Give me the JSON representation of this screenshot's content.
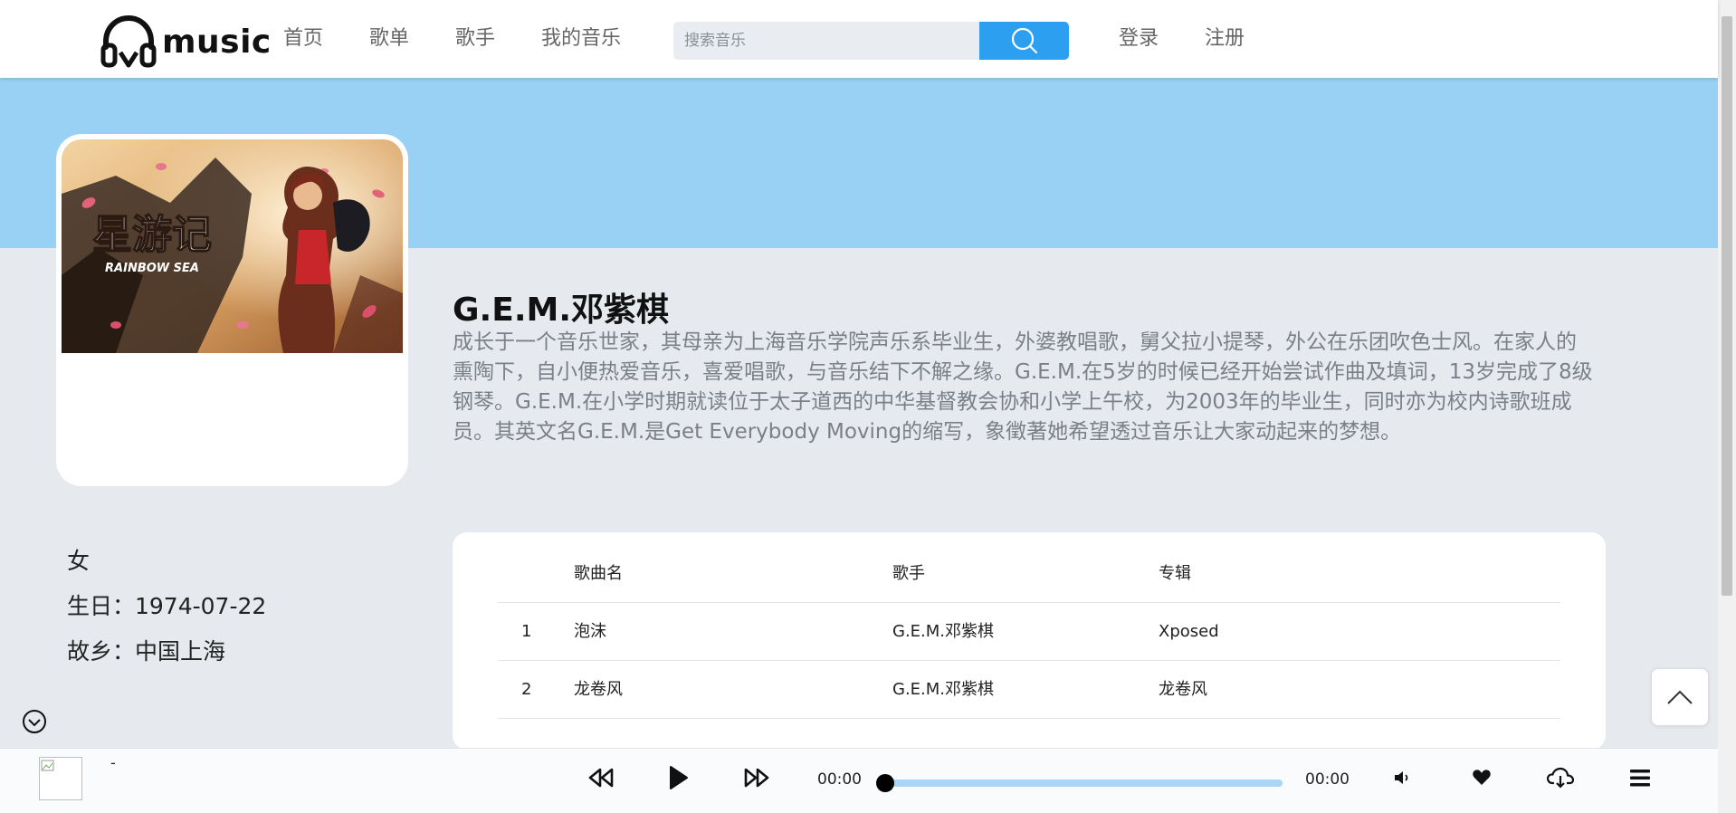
{
  "header": {
    "logo_text": "music",
    "nav": [
      "首页",
      "歌单",
      "歌手",
      "我的音乐"
    ],
    "search_placeholder": "搜索音乐",
    "login": "登录",
    "register": "注册"
  },
  "artist": {
    "name": "G.E.M.邓紫棋",
    "intro": "成长于一个音乐世家，其母亲为上海音乐学院声乐系毕业生，外婆教唱歌，舅父拉小提琴，外公在乐团吹色士风。在家人的熏陶下，自小便热爱音乐，喜爱唱歌，与音乐结下不解之缘。G.E.M.在5岁的时候已经开始尝试作曲及填词，13岁完成了8级钢琴。G.E.M.在小学时期就读位于太子道西的中华基督教会协和小学上午校，为2003年的毕业生，同时亦为校内诗歌班成员。其英文名G.E.M.是Get Everybody Moving的缩写，象徵著她希望透过音乐让大家动起来的梦想。",
    "cover_text": "星游记",
    "cover_subtext": "RAINBOW SEA",
    "gender": "女",
    "birthday": "生日：1974-07-22",
    "hometown": "故乡：中国上海"
  },
  "songs": {
    "columns": [
      "",
      "歌曲名",
      "歌手",
      "专辑"
    ],
    "rows": [
      {
        "index": "1",
        "name": "泡沫",
        "singer": "G.E.M.邓紫棋",
        "album": "Xposed"
      },
      {
        "index": "2",
        "name": "龙卷风",
        "singer": "G.E.M.邓紫棋",
        "album": "龙卷风"
      }
    ]
  },
  "player": {
    "title": "-",
    "current_time": "00:00",
    "total_time": "00:00",
    "progress": 0
  },
  "colors": {
    "banner": "#98d1f4",
    "accent": "#2d9ff0",
    "background": "#e6eaee",
    "progress_track": "#a8d6f4"
  },
  "icons": [
    "headphones-logo-icon",
    "search-icon",
    "chevron-up-icon",
    "chevron-down-circle-icon",
    "skip-back-icon",
    "play-icon",
    "skip-forward-icon",
    "volume-icon",
    "heart-icon",
    "download-cloud-icon",
    "menu-icon"
  ]
}
